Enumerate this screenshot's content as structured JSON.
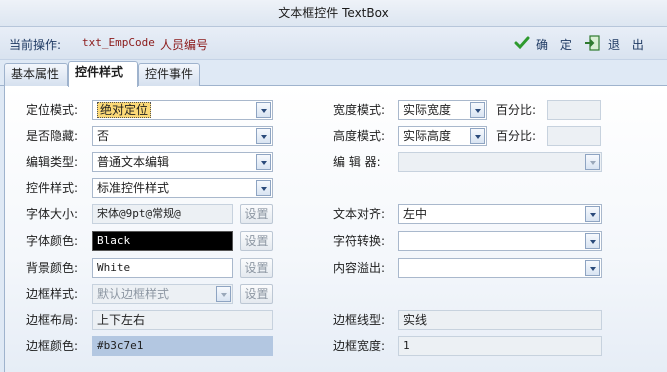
{
  "window": {
    "title": "文本框控件 TextBox"
  },
  "toolbar": {
    "current_op_label": "当前操作:",
    "control_code": "txt_EmpCode",
    "control_name": "人员编号",
    "ok_label": "确 定",
    "exit_label": "退 出"
  },
  "tabs": [
    "基本属性",
    "控件样式",
    "控件事件"
  ],
  "left": {
    "position_mode": {
      "label": "定位模式:",
      "value": "绝对定位"
    },
    "hidden": {
      "label": "是否隐藏:",
      "value": "否"
    },
    "edit_type": {
      "label": "编辑类型:",
      "value": "普通文本编辑"
    },
    "control_style": {
      "label": "控件样式:",
      "value": "标准控件样式"
    },
    "font_size": {
      "label": "字体大小:",
      "value": "宋体@9pt@常规@",
      "button": "设置"
    },
    "font_color": {
      "label": "字体颜色:",
      "value": "Black",
      "button": "设置"
    },
    "bg_color": {
      "label": "背景颜色:",
      "value": "White",
      "button": "设置"
    },
    "border_style": {
      "label": "边框样式:",
      "value": "默认边框样式",
      "button": "设置"
    },
    "border_layout": {
      "label": "边框布局:",
      "value": "上下左右"
    },
    "border_color": {
      "label": "边框颜色:",
      "value": "#b3c7e1"
    }
  },
  "right": {
    "width_mode": {
      "label": "宽度模式:",
      "value": "实际宽度",
      "pct_label": "百分比:"
    },
    "height_mode": {
      "label": "高度模式:",
      "value": "实际高度",
      "pct_label": "百分比:"
    },
    "editor": {
      "label": "编 辑 器:",
      "value": ""
    },
    "text_align": {
      "label": "文本对齐:",
      "value": "左中"
    },
    "char_convert": {
      "label": "字符转换:",
      "value": ""
    },
    "overflow": {
      "label": "内容溢出:",
      "value": ""
    },
    "border_line": {
      "label": "边框线型:",
      "value": "实线"
    },
    "border_width": {
      "label": "边框宽度:",
      "value": "1"
    }
  },
  "colors": {
    "border_color_swatch": "#b3c7e1",
    "font_color_swatch": "#000000"
  }
}
